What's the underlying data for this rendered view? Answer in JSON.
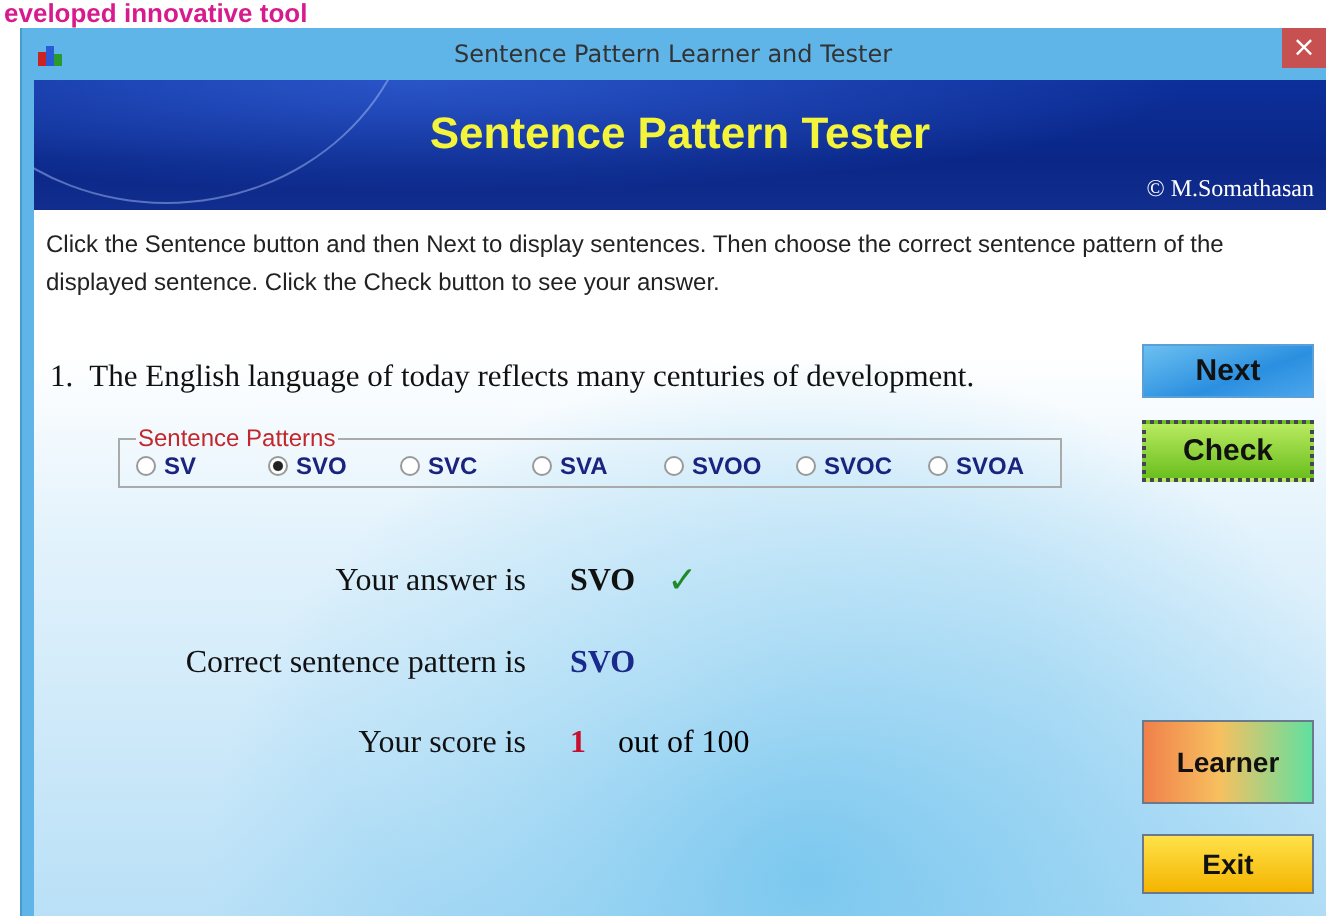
{
  "page_caption": "eveloped innovative tool",
  "window": {
    "title": "Sentence Pattern Learner and Tester",
    "close": "×"
  },
  "banner": {
    "title": "Sentence Pattern Tester",
    "credit": "© M.Somathasan"
  },
  "instructions": "Click the Sentence button and then Next to display sentences. Then choose the correct sentence pattern of the displayed sentence. Click the Check button to see your answer.",
  "question": {
    "number": "1.",
    "sentence": "The English language of today reflects many centuries of development."
  },
  "patterns": {
    "legend": "Sentence Patterns",
    "options": [
      {
        "label": "SV",
        "selected": false
      },
      {
        "label": "SVO",
        "selected": true
      },
      {
        "label": "SVC",
        "selected": false
      },
      {
        "label": "SVA",
        "selected": false
      },
      {
        "label": "SVOO",
        "selected": false
      },
      {
        "label": "SVOC",
        "selected": false
      },
      {
        "label": "SVOA",
        "selected": false
      }
    ]
  },
  "results": [
    {
      "label": "Your answer is",
      "value": "SVO",
      "mark": "✓",
      "kind": "answer"
    },
    {
      "label": "Correct sentence pattern is",
      "value": "SVO",
      "kind": "correct"
    },
    {
      "label": "Your score is",
      "value": "1",
      "suffix": "out of 100",
      "kind": "score"
    }
  ],
  "buttons": [
    {
      "label": "Next",
      "kind": "next"
    },
    {
      "label": "Check",
      "kind": "check"
    },
    {
      "label": "Learner",
      "kind": "learner"
    },
    {
      "label": "Exit",
      "kind": "exit"
    }
  ]
}
